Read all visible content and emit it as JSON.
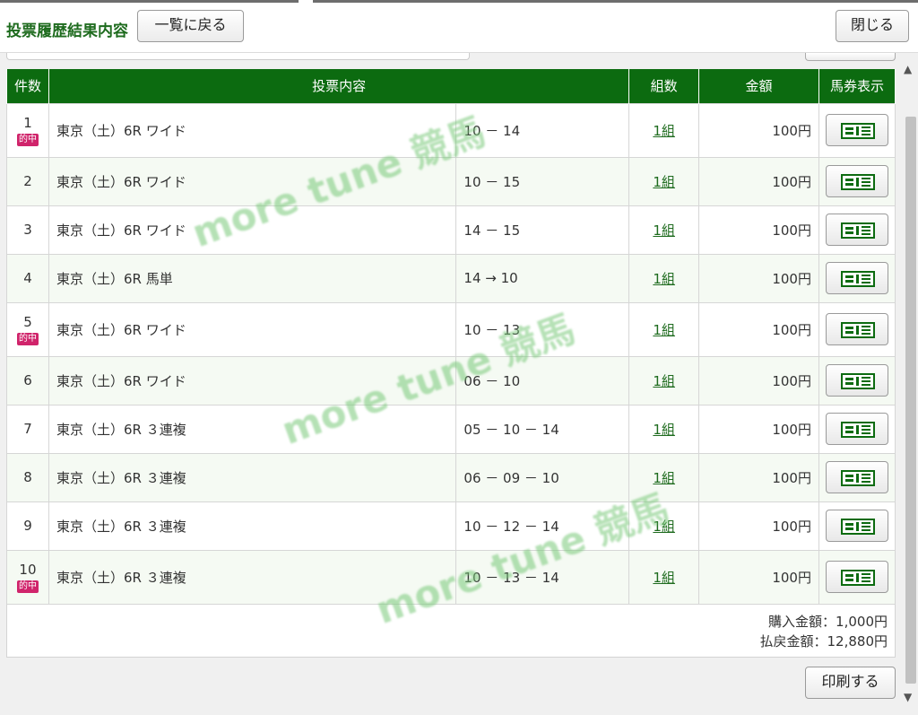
{
  "header": {
    "title": "投票履歴結果内容",
    "back_label": "一覧に戻る",
    "close_label": "閉じる"
  },
  "table": {
    "columns": [
      "件数",
      "投票内容",
      "組数",
      "金額",
      "馬券表示"
    ],
    "rows": [
      {
        "num": "1",
        "hit": "的中",
        "race": "東京（土）6R ワイド",
        "combo": "10 － 14",
        "sets": "1組",
        "amount": "100円",
        "alt": false
      },
      {
        "num": "2",
        "hit": "",
        "race": "東京（土）6R ワイド",
        "combo": "10 － 15",
        "sets": "1組",
        "amount": "100円",
        "alt": true
      },
      {
        "num": "3",
        "hit": "",
        "race": "東京（土）6R ワイド",
        "combo": "14 － 15",
        "sets": "1組",
        "amount": "100円",
        "alt": false
      },
      {
        "num": "4",
        "hit": "",
        "race": "東京（土）6R 馬単",
        "combo": "14 → 10",
        "sets": "1組",
        "amount": "100円",
        "alt": true
      },
      {
        "num": "5",
        "hit": "的中",
        "race": "東京（土）6R ワイド",
        "combo": "10 － 13",
        "sets": "1組",
        "amount": "100円",
        "alt": false
      },
      {
        "num": "6",
        "hit": "",
        "race": "東京（土）6R ワイド",
        "combo": "06 － 10",
        "sets": "1組",
        "amount": "100円",
        "alt": true
      },
      {
        "num": "7",
        "hit": "",
        "race": "東京（土）6R ３連複",
        "combo": "05 － 10 － 14",
        "sets": "1組",
        "amount": "100円",
        "alt": false
      },
      {
        "num": "8",
        "hit": "",
        "race": "東京（土）6R ３連複",
        "combo": "06 － 09 － 10",
        "sets": "1組",
        "amount": "100円",
        "alt": true
      },
      {
        "num": "9",
        "hit": "",
        "race": "東京（土）6R ３連複",
        "combo": "10 － 12 － 14",
        "sets": "1組",
        "amount": "100円",
        "alt": false
      },
      {
        "num": "10",
        "hit": "的中",
        "race": "東京（土）6R ３連複",
        "combo": "10 － 13 － 14",
        "sets": "1組",
        "amount": "100円",
        "alt": true
      }
    ]
  },
  "summary": {
    "purchase": "購入金額：1,000円",
    "payout": "払戻金額：12,880円"
  },
  "footer": {
    "print_label": "印刷する"
  },
  "watermark": "more tune 競馬",
  "colors": {
    "accent": "#0c6b10",
    "hit_badge": "#d0246b",
    "link": "#1e6b1e"
  },
  "icons": {
    "ticket": "ticket-icon",
    "scroll_up": "scroll-up-arrow",
    "scroll_down": "scroll-down-arrow"
  }
}
